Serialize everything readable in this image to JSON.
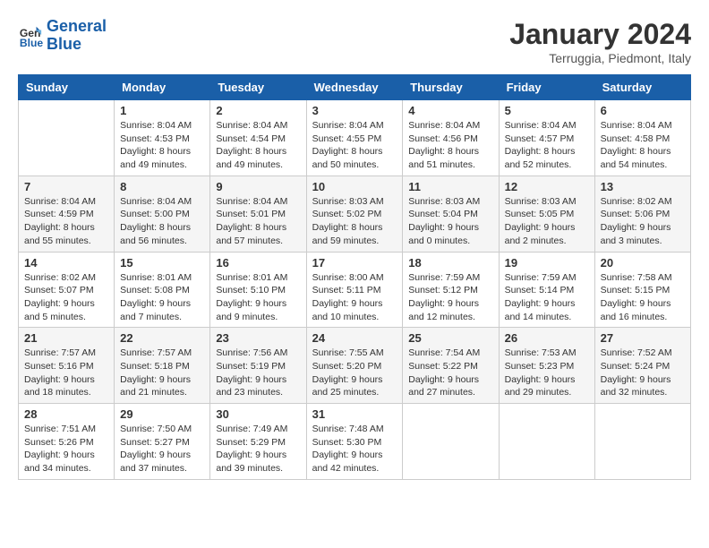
{
  "logo": {
    "line1": "General",
    "line2": "Blue"
  },
  "title": "January 2024",
  "subtitle": "Terruggia, Piedmont, Italy",
  "header_days": [
    "Sunday",
    "Monday",
    "Tuesday",
    "Wednesday",
    "Thursday",
    "Friday",
    "Saturday"
  ],
  "weeks": [
    [
      {
        "day": "",
        "sunrise": "",
        "sunset": "",
        "daylight": ""
      },
      {
        "day": "1",
        "sunrise": "Sunrise: 8:04 AM",
        "sunset": "Sunset: 4:53 PM",
        "daylight": "Daylight: 8 hours and 49 minutes."
      },
      {
        "day": "2",
        "sunrise": "Sunrise: 8:04 AM",
        "sunset": "Sunset: 4:54 PM",
        "daylight": "Daylight: 8 hours and 49 minutes."
      },
      {
        "day": "3",
        "sunrise": "Sunrise: 8:04 AM",
        "sunset": "Sunset: 4:55 PM",
        "daylight": "Daylight: 8 hours and 50 minutes."
      },
      {
        "day": "4",
        "sunrise": "Sunrise: 8:04 AM",
        "sunset": "Sunset: 4:56 PM",
        "daylight": "Daylight: 8 hours and 51 minutes."
      },
      {
        "day": "5",
        "sunrise": "Sunrise: 8:04 AM",
        "sunset": "Sunset: 4:57 PM",
        "daylight": "Daylight: 8 hours and 52 minutes."
      },
      {
        "day": "6",
        "sunrise": "Sunrise: 8:04 AM",
        "sunset": "Sunset: 4:58 PM",
        "daylight": "Daylight: 8 hours and 54 minutes."
      }
    ],
    [
      {
        "day": "7",
        "sunrise": "Sunrise: 8:04 AM",
        "sunset": "Sunset: 4:59 PM",
        "daylight": "Daylight: 8 hours and 55 minutes."
      },
      {
        "day": "8",
        "sunrise": "Sunrise: 8:04 AM",
        "sunset": "Sunset: 5:00 PM",
        "daylight": "Daylight: 8 hours and 56 minutes."
      },
      {
        "day": "9",
        "sunrise": "Sunrise: 8:04 AM",
        "sunset": "Sunset: 5:01 PM",
        "daylight": "Daylight: 8 hours and 57 minutes."
      },
      {
        "day": "10",
        "sunrise": "Sunrise: 8:03 AM",
        "sunset": "Sunset: 5:02 PM",
        "daylight": "Daylight: 8 hours and 59 minutes."
      },
      {
        "day": "11",
        "sunrise": "Sunrise: 8:03 AM",
        "sunset": "Sunset: 5:04 PM",
        "daylight": "Daylight: 9 hours and 0 minutes."
      },
      {
        "day": "12",
        "sunrise": "Sunrise: 8:03 AM",
        "sunset": "Sunset: 5:05 PM",
        "daylight": "Daylight: 9 hours and 2 minutes."
      },
      {
        "day": "13",
        "sunrise": "Sunrise: 8:02 AM",
        "sunset": "Sunset: 5:06 PM",
        "daylight": "Daylight: 9 hours and 3 minutes."
      }
    ],
    [
      {
        "day": "14",
        "sunrise": "Sunrise: 8:02 AM",
        "sunset": "Sunset: 5:07 PM",
        "daylight": "Daylight: 9 hours and 5 minutes."
      },
      {
        "day": "15",
        "sunrise": "Sunrise: 8:01 AM",
        "sunset": "Sunset: 5:08 PM",
        "daylight": "Daylight: 9 hours and 7 minutes."
      },
      {
        "day": "16",
        "sunrise": "Sunrise: 8:01 AM",
        "sunset": "Sunset: 5:10 PM",
        "daylight": "Daylight: 9 hours and 9 minutes."
      },
      {
        "day": "17",
        "sunrise": "Sunrise: 8:00 AM",
        "sunset": "Sunset: 5:11 PM",
        "daylight": "Daylight: 9 hours and 10 minutes."
      },
      {
        "day": "18",
        "sunrise": "Sunrise: 7:59 AM",
        "sunset": "Sunset: 5:12 PM",
        "daylight": "Daylight: 9 hours and 12 minutes."
      },
      {
        "day": "19",
        "sunrise": "Sunrise: 7:59 AM",
        "sunset": "Sunset: 5:14 PM",
        "daylight": "Daylight: 9 hours and 14 minutes."
      },
      {
        "day": "20",
        "sunrise": "Sunrise: 7:58 AM",
        "sunset": "Sunset: 5:15 PM",
        "daylight": "Daylight: 9 hours and 16 minutes."
      }
    ],
    [
      {
        "day": "21",
        "sunrise": "Sunrise: 7:57 AM",
        "sunset": "Sunset: 5:16 PM",
        "daylight": "Daylight: 9 hours and 18 minutes."
      },
      {
        "day": "22",
        "sunrise": "Sunrise: 7:57 AM",
        "sunset": "Sunset: 5:18 PM",
        "daylight": "Daylight: 9 hours and 21 minutes."
      },
      {
        "day": "23",
        "sunrise": "Sunrise: 7:56 AM",
        "sunset": "Sunset: 5:19 PM",
        "daylight": "Daylight: 9 hours and 23 minutes."
      },
      {
        "day": "24",
        "sunrise": "Sunrise: 7:55 AM",
        "sunset": "Sunset: 5:20 PM",
        "daylight": "Daylight: 9 hours and 25 minutes."
      },
      {
        "day": "25",
        "sunrise": "Sunrise: 7:54 AM",
        "sunset": "Sunset: 5:22 PM",
        "daylight": "Daylight: 9 hours and 27 minutes."
      },
      {
        "day": "26",
        "sunrise": "Sunrise: 7:53 AM",
        "sunset": "Sunset: 5:23 PM",
        "daylight": "Daylight: 9 hours and 29 minutes."
      },
      {
        "day": "27",
        "sunrise": "Sunrise: 7:52 AM",
        "sunset": "Sunset: 5:24 PM",
        "daylight": "Daylight: 9 hours and 32 minutes."
      }
    ],
    [
      {
        "day": "28",
        "sunrise": "Sunrise: 7:51 AM",
        "sunset": "Sunset: 5:26 PM",
        "daylight": "Daylight: 9 hours and 34 minutes."
      },
      {
        "day": "29",
        "sunrise": "Sunrise: 7:50 AM",
        "sunset": "Sunset: 5:27 PM",
        "daylight": "Daylight: 9 hours and 37 minutes."
      },
      {
        "day": "30",
        "sunrise": "Sunrise: 7:49 AM",
        "sunset": "Sunset: 5:29 PM",
        "daylight": "Daylight: 9 hours and 39 minutes."
      },
      {
        "day": "31",
        "sunrise": "Sunrise: 7:48 AM",
        "sunset": "Sunset: 5:30 PM",
        "daylight": "Daylight: 9 hours and 42 minutes."
      },
      {
        "day": "",
        "sunrise": "",
        "sunset": "",
        "daylight": ""
      },
      {
        "day": "",
        "sunrise": "",
        "sunset": "",
        "daylight": ""
      },
      {
        "day": "",
        "sunrise": "",
        "sunset": "",
        "daylight": ""
      }
    ]
  ]
}
